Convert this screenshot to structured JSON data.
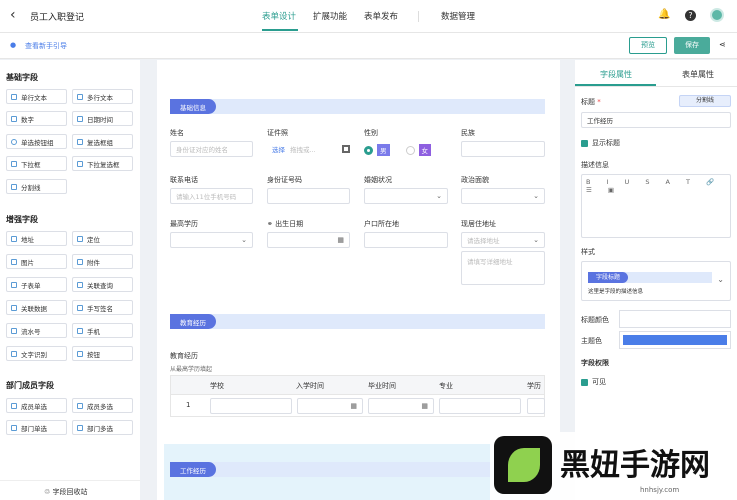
{
  "header": {
    "title": "员工入职登记",
    "tabs": [
      "表单设计",
      "扩展功能",
      "表单发布",
      "数据管理"
    ]
  },
  "subbar": {
    "guide": "查看新手引导",
    "preview": "预览",
    "save": "保存"
  },
  "left": {
    "basic_title": "基础字段",
    "basic": [
      "单行文本",
      "多行文本",
      "数字",
      "日期时间",
      "单选按钮组",
      "复选框组",
      "下拉框",
      "下拉复选框",
      "分割线"
    ],
    "enhanced_title": "增强字段",
    "enhanced": [
      "地址",
      "定位",
      "图片",
      "附件",
      "子表单",
      "关联查询",
      "关联数据",
      "手写签名",
      "流水号",
      "手机",
      "文字识别",
      "按钮"
    ],
    "dept_title": "部门成员字段",
    "dept": [
      "成员单选",
      "成员多选",
      "部门单选",
      "部门多选"
    ],
    "recycle": "字段回收站"
  },
  "canvas": {
    "sec1": "基础信息",
    "name_lbl": "姓名",
    "name_ph": "身份证对应的姓名",
    "id_lbl": "证件照",
    "id_choose": "选择",
    "id_hint": "拖拽或...",
    "gender_lbl": "性别",
    "male": "男",
    "female": "女",
    "nation_lbl": "民族",
    "phone_lbl": "联系电话",
    "phone_ph": "请输入11位手机号码",
    "idno_lbl": "身份证号码",
    "marital_lbl": "婚姻状况",
    "political_lbl": "政治面貌",
    "edu_lbl": "最高学历",
    "birth_lbl": "出生日期",
    "hukou_lbl": "户口所在地",
    "addr_lbl": "现居住地址",
    "addr_ph": "请选择地址",
    "addr_detail": "请填写详细地址",
    "sec2": "教育经历",
    "edu_title": "教育经历",
    "edu_sub": "从最高学历填起",
    "table_cols": [
      "学校",
      "入学时间",
      "毕业时间",
      "专业",
      "学历"
    ],
    "row1": "1",
    "sec3": "工作经历"
  },
  "right": {
    "tab1": "字段属性",
    "tab2": "表单属性",
    "title_lbl": "标题",
    "title_val": "工作经历",
    "divider_btn": "分割线",
    "show_title": "显示标题",
    "desc_lbl": "描述信息",
    "style_lbl": "样式",
    "style_title": "字段标题",
    "style_desc": "这里是字段的描述信息",
    "title_color": "标题颜色",
    "theme_color": "主题色",
    "perm_lbl": "字段权限",
    "visible": "可见"
  },
  "watermark": {
    "text": "黑妞手游网",
    "url": "hnhsjy.com"
  },
  "colors": {
    "accent": "#2a9d8f",
    "section": "#5a73e0",
    "theme": "#4a7de8"
  }
}
